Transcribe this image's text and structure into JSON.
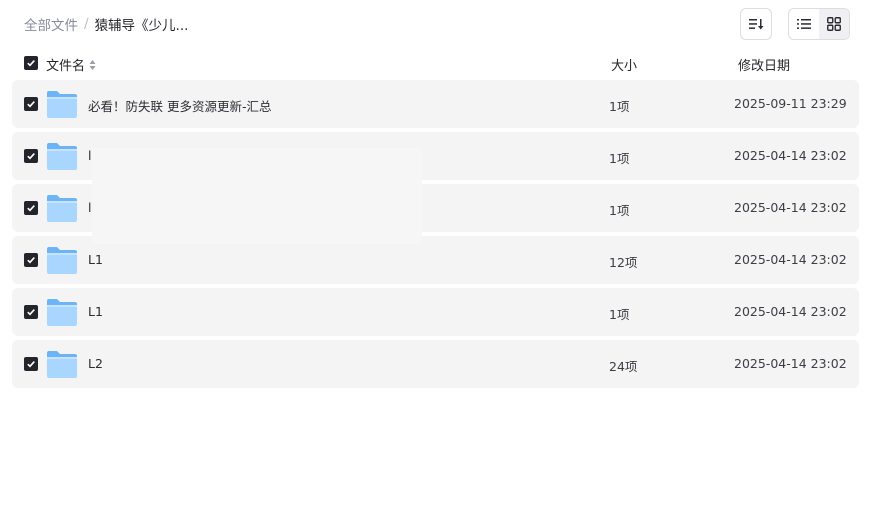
{
  "breadcrumb": {
    "root": "全部文件",
    "separator": "/",
    "current": "猿辅导《少儿..."
  },
  "toolbar": {
    "sort_icon": "sort-icon",
    "list_view_icon": "list-view-icon",
    "grid_view_icon": "grid-view-icon",
    "active_view": "list"
  },
  "table": {
    "headers": {
      "name": "文件名",
      "size": "大小",
      "date": "修改日期"
    },
    "rows": [
      {
        "name": "必看！防失联 更多资源更新-汇总",
        "size": "1项",
        "date": "2025-09-11 23:29",
        "checked": true
      },
      {
        "name": "l",
        "size": "1项",
        "date": "2025-04-14 23:02",
        "checked": true
      },
      {
        "name": "l",
        "size": "1项",
        "date": "2025-04-14 23:02",
        "checked": true
      },
      {
        "name": "L1",
        "size": "12项",
        "date": "2025-04-14 23:02",
        "checked": true
      },
      {
        "name": "L1",
        "size": "1项",
        "date": "2025-04-14 23:02",
        "checked": true
      },
      {
        "name": "L2",
        "size": "24项",
        "date": "2025-04-14 23:02",
        "checked": true
      }
    ]
  },
  "colors": {
    "checkbox": "#24252b",
    "row_bg": "#f4f4f4",
    "folder_light": "#a9d6ff",
    "folder_dark": "#6cb4f5"
  }
}
